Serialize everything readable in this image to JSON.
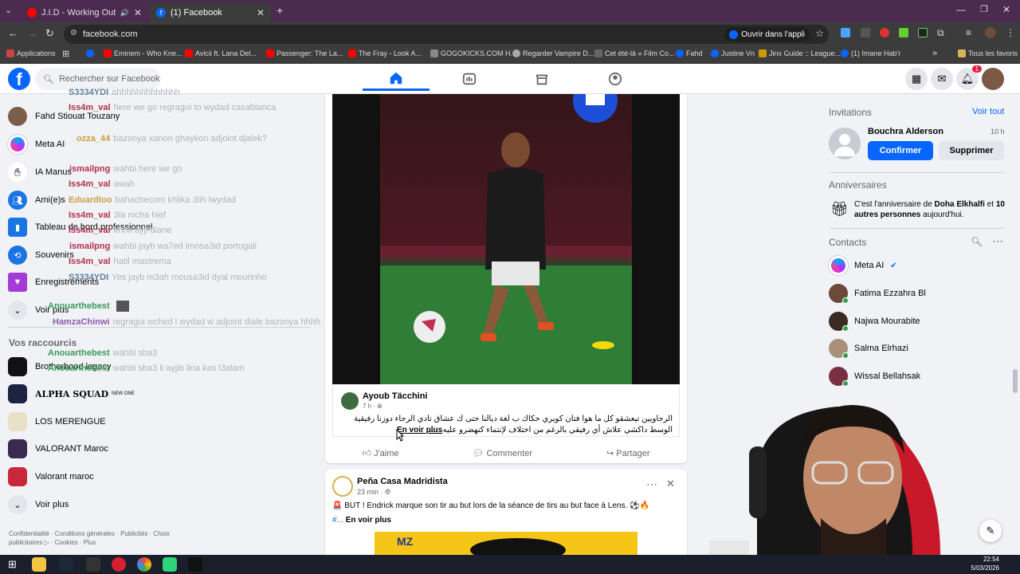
{
  "browser": {
    "tabs": [
      {
        "label": "J.I.D - Working Out | A COL",
        "active": false
      },
      {
        "label": "(1) Facebook",
        "active": true
      }
    ],
    "url": "facebook.com",
    "open_app": "Ouvrir dans l'appli",
    "bookmarks": [
      "Applications",
      "Eminem - Who Kne...",
      "Avicii ft. Lana Del...",
      "Passenger: The La...",
      "The Fray - Look A...",
      "GOGOKICKS.COM H...",
      "Regarder Vampire D...",
      "Cet été-là « Film Co...",
      "Fahd",
      "Justine Vn",
      "Jinx Guide :: League...",
      "(1) Imane Hab'r"
    ],
    "all_favorites": "Tous les favoris"
  },
  "header": {
    "search_placeholder": "Rechercher sur Facebook",
    "notifications_count": "1"
  },
  "sidebar": {
    "items": [
      {
        "label": "Fahd Stiouat Touzany",
        "icon": "avatar"
      },
      {
        "label": "Meta AI",
        "icon": "meta-ai-icon"
      },
      {
        "label": "IA Manus",
        "icon": "manus-icon"
      },
      {
        "label": "Ami(e)s",
        "icon": "friends-icon"
      },
      {
        "label": "Tableau de bord professionnel",
        "icon": "dashboard-icon"
      },
      {
        "label": "Souvenirs",
        "icon": "memories-icon"
      },
      {
        "label": "Enregistrements",
        "icon": "bookmark-icon"
      },
      {
        "label": "Voir plus",
        "icon": "chevron-down-icon"
      }
    ],
    "shortcuts_title": "Vos raccourcis",
    "shortcuts": [
      {
        "label": "Brotherhood legacy"
      },
      {
        "label": "ALPHA SQUAD",
        "badge": "NEW ONE"
      },
      {
        "label": "LOS MERENGUE"
      },
      {
        "label": "VALORANT Maroc"
      },
      {
        "label": "Valorant maroc"
      },
      {
        "label": "Voir plus"
      }
    ],
    "footer": "Confidentialité · Conditions générales · Publicités · Choix publicitaires ▷ · Cookies · Plus"
  },
  "chat": [
    {
      "user": "S3334YDI",
      "msg": "ahhhhhhhhhhhhh",
      "color": "#5a7f9e"
    },
    {
      "user": "Iss4m_val",
      "msg": "here we go regragui to wydad casablanca",
      "color": "#b0304a"
    },
    {
      "user": "ozza_44",
      "msg": "bazonya xanon ghaykon adjoint djalek?",
      "color": "#c8a040"
    },
    {
      "user": "ismailpng",
      "msg": "wahbi here we go",
      "color": "#b0304a"
    },
    {
      "user": "Iss4m_val",
      "msg": "awah",
      "color": "#b0304a"
    },
    {
      "user": "Eduardloo",
      "msg": "bahachecom khlika 3lih lwydad",
      "color": "#c8a040"
    },
    {
      "user": "Iss4m_val",
      "msg": "3la mcha hief",
      "color": "#b0304a"
    },
    {
      "user": "Iss4m_val",
      "msg": "khoti ayji diane",
      "color": "#b0304a"
    },
    {
      "user": "ismailpng",
      "msg": "wahbi jayb wa7ed lmosa3id portugali",
      "color": "#b0304a"
    },
    {
      "user": "Iss4m_val",
      "msg": "hatil mastrema",
      "color": "#b0304a"
    },
    {
      "user": "S3334YDI",
      "msg": "Yes jayb m3ah mousa3id dyal mourinho",
      "color": "#5a7f9e"
    },
    {
      "user": "Anouarthebest",
      "msg": "",
      "color": "#3a9a5a"
    },
    {
      "user": "HamzaChinwi",
      "msg": "regragui wched l wydad w adjoint diale bazonya hhhh",
      "color": "#8a5ab0"
    },
    {
      "user": "Anouarthebest",
      "msg": "wahbi sba3",
      "color": "#3a9a5a"
    },
    {
      "user": "Anouarthebest",
      "msg": "wahbi sba3 li ayjib lina kas l3alam",
      "color": "#3a9a5a"
    }
  ],
  "post1": {
    "author": "Ayoub Täcchini",
    "time": "7 h ·",
    "text_line1": "الرجاويين تيعشقو كل ما هوا فتان كويري حكاك ب لغة ديالنا حتى ك عشاق تادي الرجاء دوزنا رفيقية",
    "text_line2": "الوسط داكشي علاش أي رفيقي بالرغم من اختلاف لإنتماء كنهضرو عليه .. ...",
    "see_more": "En voir plus",
    "actions": [
      "J'aime",
      "Commenter",
      "Partager"
    ]
  },
  "post2": {
    "author": "Peña Casa Madridista",
    "time": "23 min ·",
    "text": "🚨 BUT ! Endrick marque son tir au but lors de la séance de tirs au but face à Lens. ⚽🔥",
    "hashtag": "#...",
    "see_more": "En voir plus"
  },
  "right": {
    "invitations_title": "Invitations",
    "see_all": "Voir tout",
    "invite_name": "Bouchra Alderson",
    "invite_time": "10 h",
    "confirm": "Confirmer",
    "delete": "Supprimer",
    "birthdays_title": "Anniversaires",
    "birthday_pre": "C'est l'anniversaire de ",
    "birthday_name": "Doha Elkhalfi",
    "birthday_mid": " et ",
    "birthday_others": "10 autres personnes",
    "birthday_post": " aujourd'hui.",
    "contacts_title": "Contacts",
    "contacts": [
      "Meta AI",
      "Fatima Ezzahra Bl",
      "Najwa Mourabite",
      "Salma Elrhazi",
      "Wissal Bellahsak"
    ]
  },
  "taskbar": {
    "time": "22:54",
    "date": "5/03/2026"
  },
  "colors": {
    "fb_blue": "#0866ff",
    "tab_bg": "#4b2b4f",
    "toolbar": "#3c3c3c"
  }
}
